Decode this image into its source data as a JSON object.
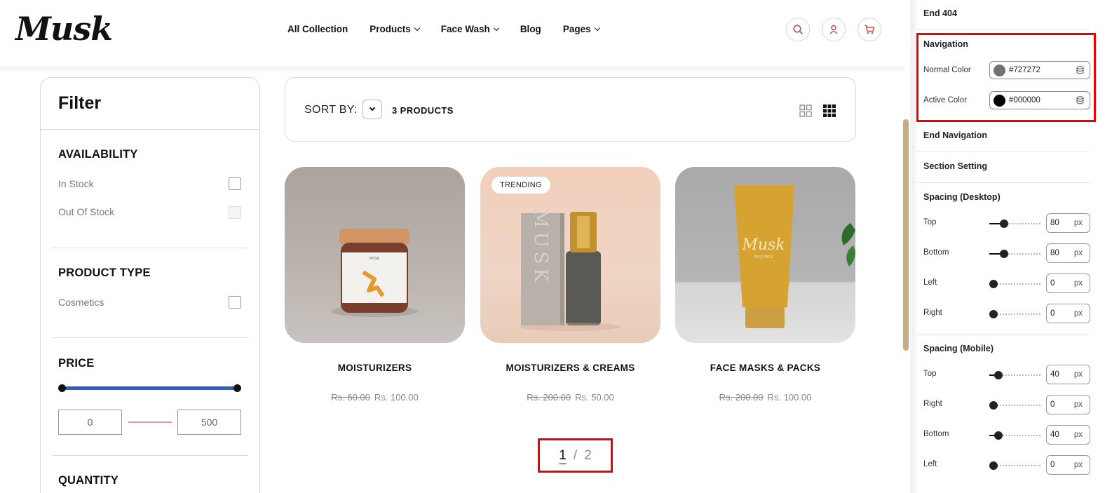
{
  "header": {
    "logo": "Musk",
    "nav": [
      {
        "label": "All Collection",
        "dropdown": false
      },
      {
        "label": "Products",
        "dropdown": true
      },
      {
        "label": "Face Wash",
        "dropdown": true
      },
      {
        "label": "Blog",
        "dropdown": false
      },
      {
        "label": "Pages",
        "dropdown": true
      }
    ],
    "icons": [
      "search-icon",
      "user-icon",
      "cart-icon"
    ],
    "icon_color": "#c0504d"
  },
  "filter": {
    "title": "Filter",
    "availability": {
      "title": "AVAILABILITY",
      "options": [
        {
          "label": "In Stock",
          "checked": false,
          "disabled": false
        },
        {
          "label": "Out Of Stock",
          "checked": false,
          "disabled": true
        }
      ]
    },
    "product_type": {
      "title": "PRODUCT TYPE",
      "options": [
        {
          "label": "Cosmetics",
          "checked": false
        }
      ]
    },
    "price": {
      "title": "PRICE",
      "min": "0",
      "max": "500",
      "track_color": "#2a5fc7"
    },
    "quantity": {
      "title": "QUANTITY"
    }
  },
  "sort": {
    "label": "SORT BY:",
    "count": "3 PRODUCTS",
    "view_icons": [
      "grid-2-icon",
      "grid-3-icon"
    ]
  },
  "products": [
    {
      "name": "MOISTURIZERS",
      "old_price": "Rs. 60.00",
      "price": "Rs. 100.00",
      "badge": ""
    },
    {
      "name": "MOISTURIZERS & CREAMS",
      "old_price": "Rs. 200.00",
      "price": "Rs. 50.00",
      "badge": "TRENDING"
    },
    {
      "name": "FACE MASKS & PACKS",
      "old_price": "Rs. 200.00",
      "price": "Rs. 100.00",
      "badge": ""
    }
  ],
  "product_art": [
    {
      "label": "MUSK"
    },
    {
      "label": "MUSK"
    },
    {
      "label": "Musk",
      "sublabel": "FACE PACK"
    }
  ],
  "pagination": {
    "current": "1",
    "separator": "/",
    "total": "2"
  },
  "panel": {
    "end_404": "End 404",
    "navigation": {
      "title": "Navigation",
      "normal_label": "Normal Color",
      "normal_value": "#727272",
      "normal_color": "#727272",
      "active_label": "Active Color",
      "active_value": "#000000",
      "active_color": "#000000"
    },
    "end_navigation": "End Navigation",
    "section_setting": "Section Setting",
    "spacing_desktop": {
      "title": "Spacing (Desktop)",
      "items": [
        {
          "label": "Top",
          "value": "80",
          "unit": "px",
          "level": 0.21
        },
        {
          "label": "Bottom",
          "value": "80",
          "unit": "px",
          "level": 0.21
        },
        {
          "label": "Left",
          "value": "0",
          "unit": "px",
          "level": 0
        },
        {
          "label": "Right",
          "value": "0",
          "unit": "px",
          "level": 0
        }
      ]
    },
    "spacing_mobile": {
      "title": "Spacing (Mobile)",
      "items": [
        {
          "label": "Top",
          "value": "40",
          "unit": "px",
          "level": 0.1
        },
        {
          "label": "Right",
          "value": "0",
          "unit": "px",
          "level": 0
        },
        {
          "label": "Bottom",
          "value": "40",
          "unit": "px",
          "level": 0.1
        },
        {
          "label": "Left",
          "value": "0",
          "unit": "px",
          "level": 0
        }
      ]
    }
  }
}
